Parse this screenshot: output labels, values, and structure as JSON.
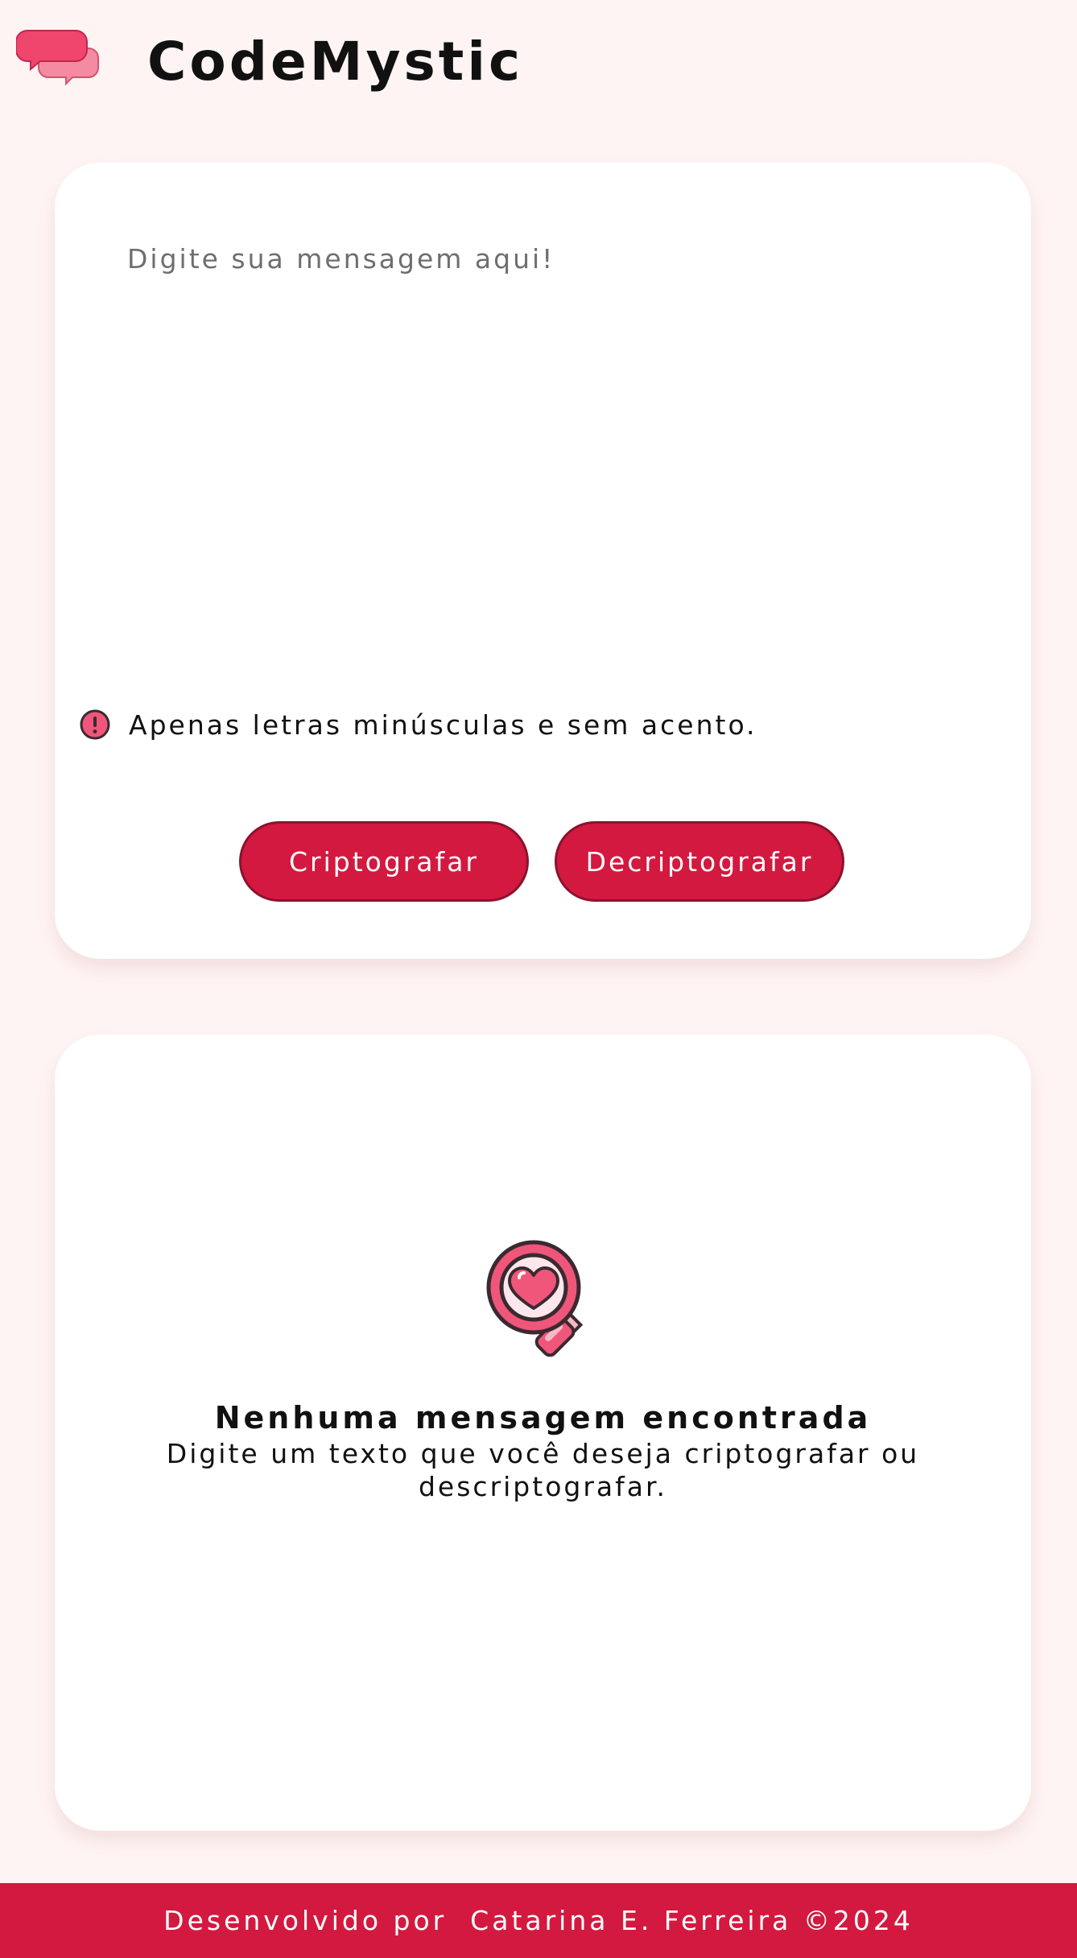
{
  "header": {
    "title": "CodeMystic",
    "logo_icon": "chat-bubbles-icon"
  },
  "input_card": {
    "placeholder": "Digite sua mensagem aqui!",
    "value": "",
    "hint_icon": "exclamation-circle-icon",
    "hint": "Apenas letras minúsculas e sem acento.",
    "encrypt_label": "Criptografar",
    "decrypt_label": "Decriptografar"
  },
  "output_card": {
    "icon": "magnifier-heart-icon",
    "title": "Nenhuma mensagem encontrada",
    "description": "Digite um texto que você deseja criptografar ou descriptografar."
  },
  "footer": {
    "text": "Desenvolvido por  Catarina E. Ferreira ©2024"
  },
  "colors": {
    "accent": "#d3193f",
    "background": "#fff4f4",
    "card": "#ffffff",
    "icon_pink": "#f0567a"
  }
}
